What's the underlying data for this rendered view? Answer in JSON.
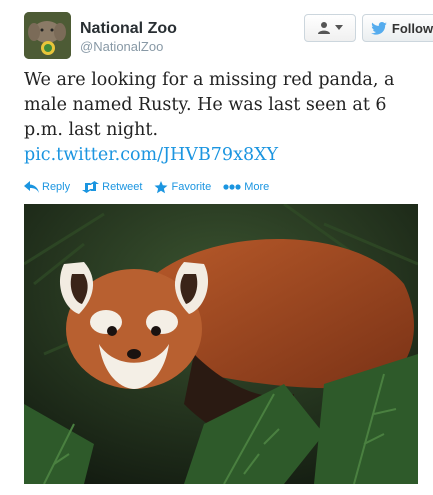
{
  "header": {
    "display_name": "National Zoo",
    "screen_name": "@NationalZoo",
    "follow_label": "Follow"
  },
  "tweet": {
    "text": "We are looking for a missing red panda, a male named Rusty. He was last seen at 6 p.m. last night.",
    "link": "pic.twitter.com/JHVB79x8XY"
  },
  "actions": {
    "reply": "Reply",
    "retweet": "Retweet",
    "favorite": "Favorite",
    "more": "More"
  },
  "colors": {
    "link": "#1b95e0",
    "twitter_blue": "#55acee"
  },
  "icons": {
    "avatar": "elephant-avatar-icon",
    "user_menu": "person-icon",
    "follow": "twitter-bird-icon",
    "reply": "reply-arrow-icon",
    "retweet": "retweet-icon",
    "favorite": "star-icon",
    "more": "ellipsis-icon"
  }
}
